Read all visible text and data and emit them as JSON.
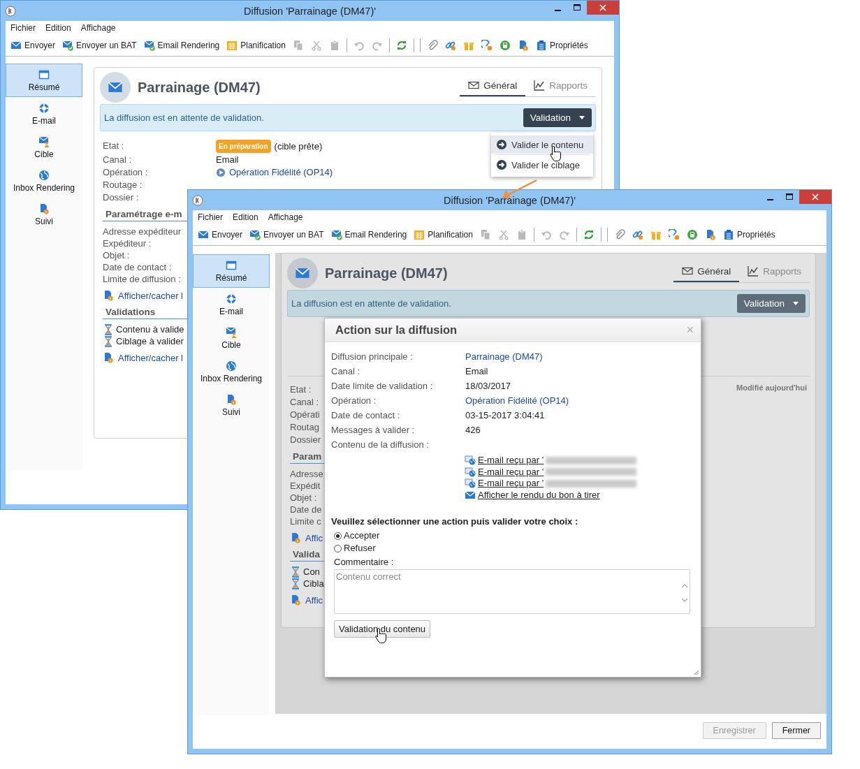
{
  "back_window": {
    "title": "Diffusion 'Parrainage (DM47)'",
    "menu": [
      "Fichier",
      "Edition",
      "Affichage"
    ],
    "toolbar": [
      {
        "kind": "button",
        "label": "Envoyer"
      },
      {
        "kind": "button",
        "label": "Envoyer un BAT"
      },
      {
        "kind": "button",
        "label": "Email Rendering"
      },
      {
        "kind": "button",
        "label": "Planification"
      },
      {
        "kind": "icon",
        "disabled": true
      },
      {
        "kind": "icon",
        "disabled": true
      },
      {
        "kind": "icon",
        "disabled": true
      },
      {
        "kind": "separator"
      },
      {
        "kind": "icon",
        "disabled": true
      },
      {
        "kind": "icon",
        "disabled": true
      },
      {
        "kind": "separator"
      },
      {
        "kind": "icon",
        "disabled": false
      },
      {
        "kind": "separator"
      },
      {
        "kind": "separator"
      },
      {
        "kind": "icon",
        "disabled": false
      },
      {
        "kind": "icon",
        "disabled": false
      },
      {
        "kind": "icon",
        "disabled": false
      },
      {
        "kind": "icon",
        "disabled": false
      },
      {
        "kind": "icon",
        "disabled": false
      },
      {
        "kind": "icon",
        "disabled": false
      },
      {
        "kind": "button",
        "label": "Propriétés"
      }
    ],
    "sidebar": [
      {
        "label": "Résumé",
        "selected": true
      },
      {
        "label": "E-mail",
        "selected": false
      },
      {
        "label": "Cible",
        "selected": false
      },
      {
        "label": "Inbox Rendering",
        "selected": false
      },
      {
        "label": "Suivi",
        "selected": false
      }
    ],
    "header": {
      "title": "Parrainage (DM47)",
      "tabs": [
        {
          "label": "Général",
          "selected": true
        },
        {
          "label": "Rapports",
          "selected": false
        }
      ]
    },
    "banner": {
      "text": "La diffusion est en attente de validation.",
      "button": "Validation"
    },
    "dropdown": [
      {
        "label": "Valider le contenu",
        "highlighted": true
      },
      {
        "label": "Valider le ciblage",
        "highlighted": false
      }
    ],
    "details": [
      {
        "kind": "status",
        "label": "Etat :",
        "badge": "En préparation",
        "value": "(cible prête)"
      },
      {
        "kind": "text",
        "label": "Canal :",
        "value": "Email"
      },
      {
        "kind": "link",
        "label": "Opération :",
        "value": "Opération Fidélité (OP14)"
      },
      {
        "kind": "text",
        "label": "Routage :"
      },
      {
        "kind": "text",
        "label": "Dossier :"
      }
    ],
    "sections": [
      {
        "kind": "fields",
        "title": "Paramétrage e-m",
        "rows": [
          "Adresse expéditeur",
          "Expéditeur :",
          "Objet :",
          "Date de contact :",
          "Limite de diffusion :"
        ],
        "link": "Afficher/cacher l"
      },
      {
        "kind": "checklist",
        "title": "Validations",
        "rows": [
          "Contenu à valide",
          "Ciblage à valider"
        ],
        "link": "Afficher/cacher l"
      }
    ]
  },
  "front_window": {
    "title": "Diffusion 'Parrainage  (DM47)'",
    "menu": [
      "Fichier",
      "Edition",
      "Affichage"
    ],
    "toolbar": [
      {
        "kind": "button",
        "label": "Envoyer"
      },
      {
        "kind": "button",
        "label": "Envoyer un BAT"
      },
      {
        "kind": "button",
        "label": "Email Rendering"
      },
      {
        "kind": "button",
        "label": "Planification"
      },
      {
        "kind": "icon",
        "disabled": true
      },
      {
        "kind": "icon",
        "disabled": true
      },
      {
        "kind": "icon",
        "disabled": true
      },
      {
        "kind": "separator"
      },
      {
        "kind": "icon",
        "disabled": true
      },
      {
        "kind": "icon",
        "disabled": true
      },
      {
        "kind": "separator"
      },
      {
        "kind": "icon",
        "disabled": false
      },
      {
        "kind": "separator"
      },
      {
        "kind": "separator"
      },
      {
        "kind": "icon",
        "disabled": false
      },
      {
        "kind": "icon",
        "disabled": false
      },
      {
        "kind": "icon",
        "disabled": false
      },
      {
        "kind": "icon",
        "disabled": false
      },
      {
        "kind": "icon",
        "disabled": false
      },
      {
        "kind": "icon",
        "disabled": false
      },
      {
        "kind": "button",
        "label": "Propriétés"
      }
    ],
    "sidebar": [
      {
        "label": "Résumé",
        "selected": true
      },
      {
        "label": "E-mail",
        "selected": false
      },
      {
        "label": "Cible",
        "selected": false
      },
      {
        "label": "Inbox Rendering",
        "selected": false
      },
      {
        "label": "Suivi",
        "selected": false
      }
    ],
    "header": {
      "title": "Parrainage (DM47)",
      "tabs": [
        {
          "label": "Général",
          "selected": true
        },
        {
          "label": "Rapports",
          "selected": false
        }
      ]
    },
    "banner": {
      "text": "La diffusion est en attente de validation.",
      "button": "Validation"
    },
    "modified": "Modifié aujourd'hui",
    "details": [
      {
        "label": "Etat :"
      },
      {
        "label": "Canal :"
      },
      {
        "label": "Opérati"
      },
      {
        "label": "Routag"
      },
      {
        "label": "Dossier"
      }
    ],
    "sections": [
      {
        "kind": "fields",
        "title": "Param",
        "rows": [
          "Adresse",
          "Expédit",
          "Objet :",
          "Date de",
          "Limite c"
        ],
        "link": "Affic"
      },
      {
        "kind": "checklist",
        "title": "Valida",
        "rows": [
          "Con",
          "Cibla"
        ],
        "link": "Affic"
      }
    ],
    "dialog": {
      "title": "Action sur la diffusion",
      "close": "×",
      "fields": [
        {
          "kind": "link",
          "label": "Diffusion principale :",
          "value": "Parrainage (DM47)"
        },
        {
          "kind": "text",
          "label": "Canal :",
          "value": "Email"
        },
        {
          "kind": "text",
          "label": "Date limite de validation :",
          "value": "18/03/2017"
        },
        {
          "kind": "link",
          "label": "Opération :",
          "value": "Opération Fidélité (OP14)"
        },
        {
          "kind": "text",
          "label": "Date de contact :",
          "value": "03-15-2017 3:04:41"
        },
        {
          "kind": "text",
          "label": "Messages à valider :",
          "value": "426"
        }
      ],
      "content_label": "Contenu de la diffusion :",
      "content_links": [
        {
          "kind": "proof",
          "label": "E-mail reçu par '"
        },
        {
          "kind": "proof",
          "label": "E-mail reçu par '"
        },
        {
          "kind": "proof",
          "label": "E-mail reçu par '"
        },
        {
          "kind": "render",
          "label": "Afficher le rendu du bon à tirer"
        }
      ],
      "question": "Veuillez sélectionner une action puis valider votre choix :",
      "options": [
        {
          "label": "Accepter",
          "selected": true
        },
        {
          "label": "Refuser",
          "selected": false
        }
      ],
      "comment_label": "Commentaire :",
      "comment": {
        "placeholder": "Contenu correct"
      },
      "button": "Validation du contenu"
    },
    "footer": [
      {
        "label": "Enregistrer",
        "disabled": true
      },
      {
        "label": "Fermer",
        "disabled": false
      }
    ]
  }
}
